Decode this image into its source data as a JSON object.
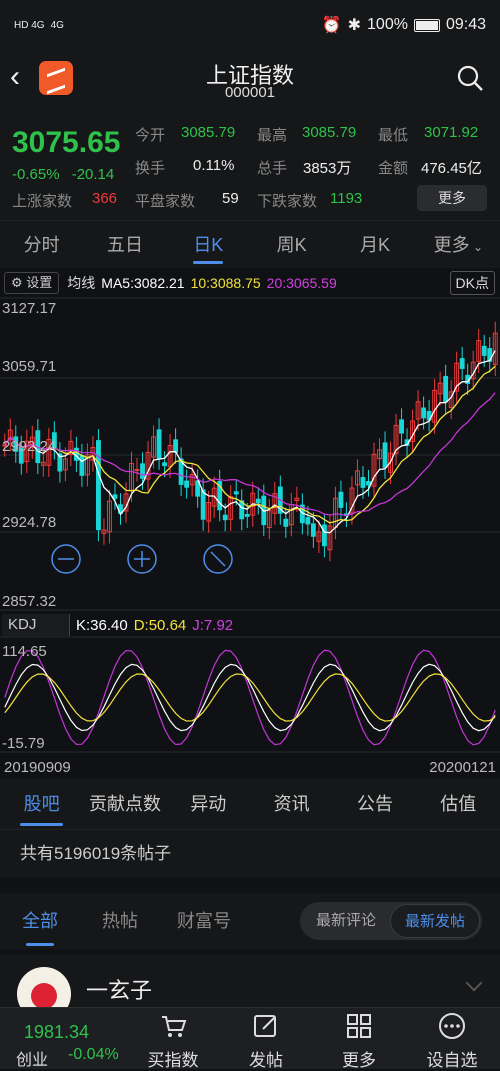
{
  "status_bar": {
    "left": [
      "HD 4G",
      "4G",
      "HD"
    ],
    "battery": "100%",
    "time": "09:43"
  },
  "header": {
    "title": "上证指数",
    "code": "000001"
  },
  "quote": {
    "price": "3075.65",
    "change_pct": "-0.65%",
    "change_abs": "-20.14",
    "open_label": "今开",
    "open": "3085.79",
    "high_label": "最高",
    "high": "3085.79",
    "low_label": "最低",
    "low": "3071.92",
    "turnover_label": "换手",
    "turnover": "0.11%",
    "volume_label": "总手",
    "volume": "3853万",
    "amount_label": "金额",
    "amount": "476.45亿",
    "up_label": "上涨家数",
    "up": "366",
    "flat_label": "平盘家数",
    "flat": "59",
    "down_label": "下跌家数",
    "down": "1193",
    "more_button": "更多"
  },
  "period_tabs": [
    "分时",
    "五日",
    "日K",
    "周K",
    "月K",
    "更多"
  ],
  "active_period": 2,
  "chart_toolbar": {
    "settings": "设置",
    "ma_label": "均线",
    "ma5": "MA5:3082.21",
    "ma10": "10:3088.75",
    "ma20": "20:3065.59",
    "dk": "DK点"
  },
  "price_axis": [
    "3127.17",
    "3059.71",
    "2992.24",
    "2924.78",
    "2857.32"
  ],
  "kdj_toolbar": {
    "tag": "KDJ",
    "k": "K:36.40",
    "d": "D:50.64",
    "j": "J:7.92"
  },
  "kdj_axis": [
    "114.65",
    "-15.79"
  ],
  "dates": {
    "start": "20190909",
    "end": "20200121"
  },
  "colors": {
    "up": "#ee3b3b",
    "down": "#2ec24a",
    "candle_down": "#19d6d6",
    "ma5": "#ffffff",
    "ma10": "#f2e33b",
    "ma20": "#c236d6",
    "accent": "#4d8fe8"
  },
  "sub_tabs": [
    "股吧",
    "贡献点数",
    "异动",
    "资讯",
    "公告",
    "估值"
  ],
  "active_sub_tab": 0,
  "posts_count": "共有5196019条帖子",
  "feed_tabs": [
    "全部",
    "热帖",
    "财富号"
  ],
  "sort_options": [
    "最新评论",
    "最新发帖"
  ],
  "post": {
    "username": "一玄子"
  },
  "bottom_nav": {
    "index_value": "1981.34",
    "index_name": "创业",
    "index_change": "-0.04%",
    "items": [
      {
        "label": "买指数",
        "icon": "buy-icon"
      },
      {
        "label": "发帖",
        "icon": "edit-icon"
      },
      {
        "label": "更多",
        "icon": "grid-icon"
      },
      {
        "label": "设自选",
        "icon": "more-dots-icon"
      }
    ]
  },
  "chart_data": {
    "type": "candlestick",
    "price_axis_range": [
      2857.32,
      3127.17
    ],
    "kdj_axis_range": [
      -15.79,
      114.65
    ],
    "date_range": [
      "20190909",
      "20200121"
    ],
    "ma": {
      "MA5": 3082.21,
      "MA10": 3088.75,
      "MA20": 3065.59
    },
    "kdj": {
      "K": 36.4,
      "D": 50.64,
      "J": 7.92
    }
  }
}
